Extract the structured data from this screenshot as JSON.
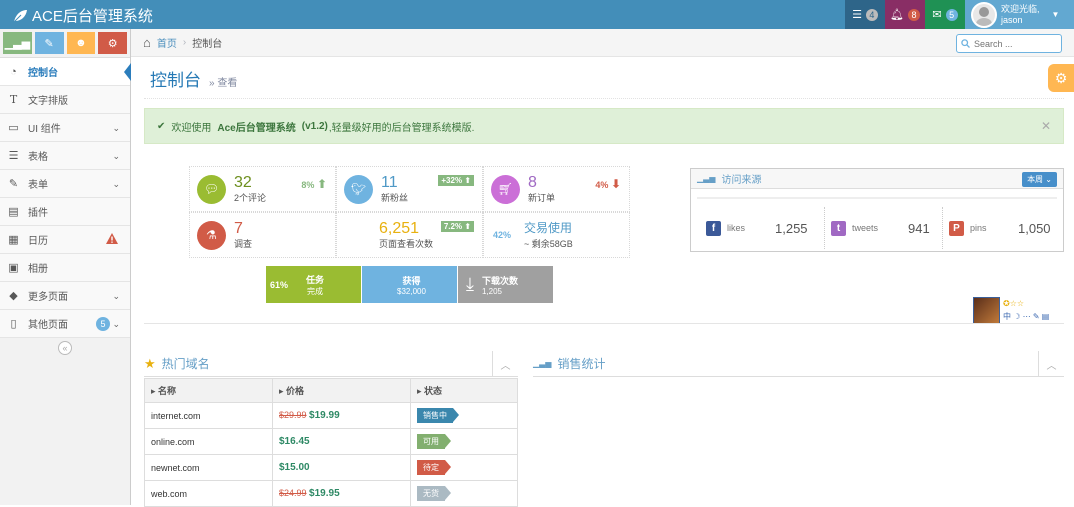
{
  "brand": {
    "title": "ACE后台管理系统"
  },
  "navbar": {
    "tasks_count": "4",
    "notifications_count": "8",
    "messages_count": "5",
    "user_greeting": "欢迎光临,",
    "user_name": "jason"
  },
  "breadcrumb": {
    "home": "首页",
    "current": "控制台"
  },
  "search": {
    "placeholder": "Search ..."
  },
  "sidebar": {
    "items": [
      {
        "label": "控制台",
        "icon": "dashboard-icon"
      },
      {
        "label": "文字排版",
        "icon": "text-icon"
      },
      {
        "label": "UI 组件",
        "icon": "desktop-icon"
      },
      {
        "label": "表格",
        "icon": "list-icon"
      },
      {
        "label": "表单",
        "icon": "edit-icon"
      },
      {
        "label": "插件",
        "icon": "list-alt-icon"
      },
      {
        "label": "日历",
        "icon": "calendar-icon"
      },
      {
        "label": "相册",
        "icon": "picture-icon"
      },
      {
        "label": "更多页面",
        "icon": "tag-icon"
      },
      {
        "label": "其他页面",
        "icon": "file-icon",
        "badge": "5"
      }
    ]
  },
  "page_header": {
    "title": "控制台",
    "subtitle": "查看"
  },
  "alert": {
    "prefix": "欢迎使用",
    "name": "Ace后台管理系统",
    "version": "(v1.2)",
    "suffix": ",轻量级好用的后台管理系统模版."
  },
  "infoboxes": [
    {
      "number": "32",
      "text": "2个评论",
      "stat": "8%"
    },
    {
      "number": "11",
      "text": "新粉丝",
      "stat": "+32%"
    },
    {
      "number": "8",
      "text": "新订单",
      "stat": "4%"
    },
    {
      "number": "7",
      "text": "调查"
    },
    {
      "number": "6,251",
      "text": "页面查看次数",
      "stat": "7.2%"
    },
    {
      "number": "交易使用",
      "text": "~ 剩余58GB",
      "progress": "42%"
    }
  ],
  "small_boxes": [
    {
      "percent": "61%",
      "title": "任务",
      "text": "完成"
    },
    {
      "title": "获得",
      "text": "$32,000"
    },
    {
      "title": "下载次数",
      "text": "1,205"
    }
  ],
  "visits": {
    "title": "访问来源",
    "dropdown": "本周",
    "items": [
      {
        "label": "likes",
        "value": "1,255"
      },
      {
        "label": "tweets",
        "value": "941"
      },
      {
        "label": "pins",
        "value": "1,050"
      }
    ]
  },
  "domains": {
    "title": "热门域名",
    "headers": [
      "名称",
      "价格",
      "状态"
    ],
    "rows": [
      {
        "name": "internet.com",
        "old_price": "$29.99",
        "price": "$19.99",
        "status": "销售中"
      },
      {
        "name": "online.com",
        "old_price": "",
        "price": "$16.45",
        "status": "可用"
      },
      {
        "name": "newnet.com",
        "old_price": "",
        "price": "$15.00",
        "status": "待定"
      },
      {
        "name": "web.com",
        "old_price": "$24.99",
        "price": "$19.95",
        "status": "无货"
      }
    ]
  },
  "sales": {
    "title": "销售统计"
  },
  "rating_toolbar": {
    "text": "中"
  }
}
